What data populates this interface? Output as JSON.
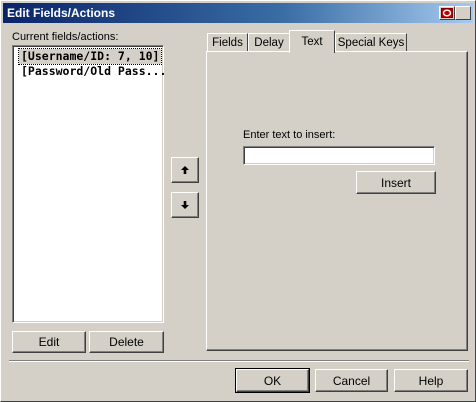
{
  "window": {
    "title": "Edit Fields/Actions"
  },
  "left": {
    "list_label": "Current fields/actions:",
    "items": [
      {
        "text": "[Username/ID: 7, 10]",
        "selected": true
      },
      {
        "text": "[Password/Old Pass...",
        "selected": false
      }
    ],
    "edit_label": "Edit",
    "delete_label": "Delete"
  },
  "move": {
    "up_icon": "arrow-up-icon",
    "down_icon": "arrow-down-icon"
  },
  "tabs": [
    {
      "label": "Fields",
      "active": false
    },
    {
      "label": "Delay",
      "active": false
    },
    {
      "label": "Text",
      "active": true
    },
    {
      "label": "Special Keys",
      "active": false
    }
  ],
  "text_tab": {
    "input_label": "Enter text to insert:",
    "input_value": "",
    "insert_label": "Insert"
  },
  "footer": {
    "ok_label": "OK",
    "cancel_label": "Cancel",
    "help_label": "Help"
  },
  "colors": {
    "face": "#d4d0c8",
    "title_start": "#0a246a",
    "title_end": "#a6caf0"
  }
}
